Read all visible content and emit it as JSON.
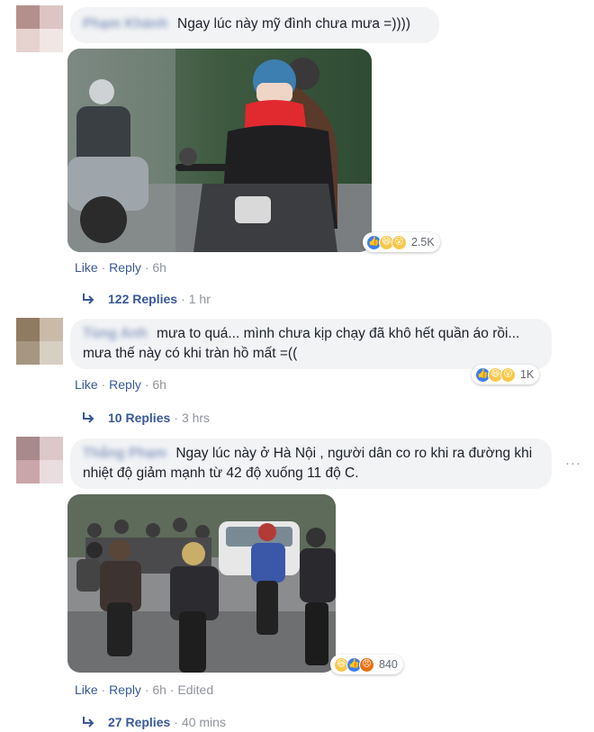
{
  "comments": [
    {
      "author": "Phạm Khánh",
      "text": "Ngay lúc này mỹ đình chưa mưa =))))",
      "reactions_count": "2.5K",
      "actions": {
        "like": "Like",
        "reply": "Reply",
        "time": "6h"
      },
      "replies": {
        "label": "122 Replies",
        "time": "1 hr"
      }
    },
    {
      "author": "Tùng Anh",
      "text": "mưa to quá... mình chưa kịp chạy đã khô hết quần áo rồi... mưa thế này có khi tràn hồ mất =((",
      "reactions_count": "1K",
      "actions": {
        "like": "Like",
        "reply": "Reply",
        "time": "6h"
      },
      "replies": {
        "label": "10 Replies",
        "time": "3 hrs"
      }
    },
    {
      "author": "Thắng Phạm",
      "text": "Ngay lúc này ở Hà Nội , người dân co ro khi ra đường khi nhiệt độ giảm mạnh từ 42 độ xuống 11 độ C.",
      "reactions_count": "840",
      "actions": {
        "like": "Like",
        "reply": "Reply",
        "time": "6h",
        "edited": "Edited"
      },
      "replies": {
        "label": "27 Replies",
        "time": "40 mins"
      }
    }
  ],
  "separator": " · ",
  "more_icon": "more-horizontal-icon",
  "colors": {
    "link": "#385898",
    "meta": "#90949c",
    "bubble": "#f2f3f5",
    "like": "#3b7ff0",
    "haha": "#f7c84a",
    "angry": "#e9710f"
  }
}
